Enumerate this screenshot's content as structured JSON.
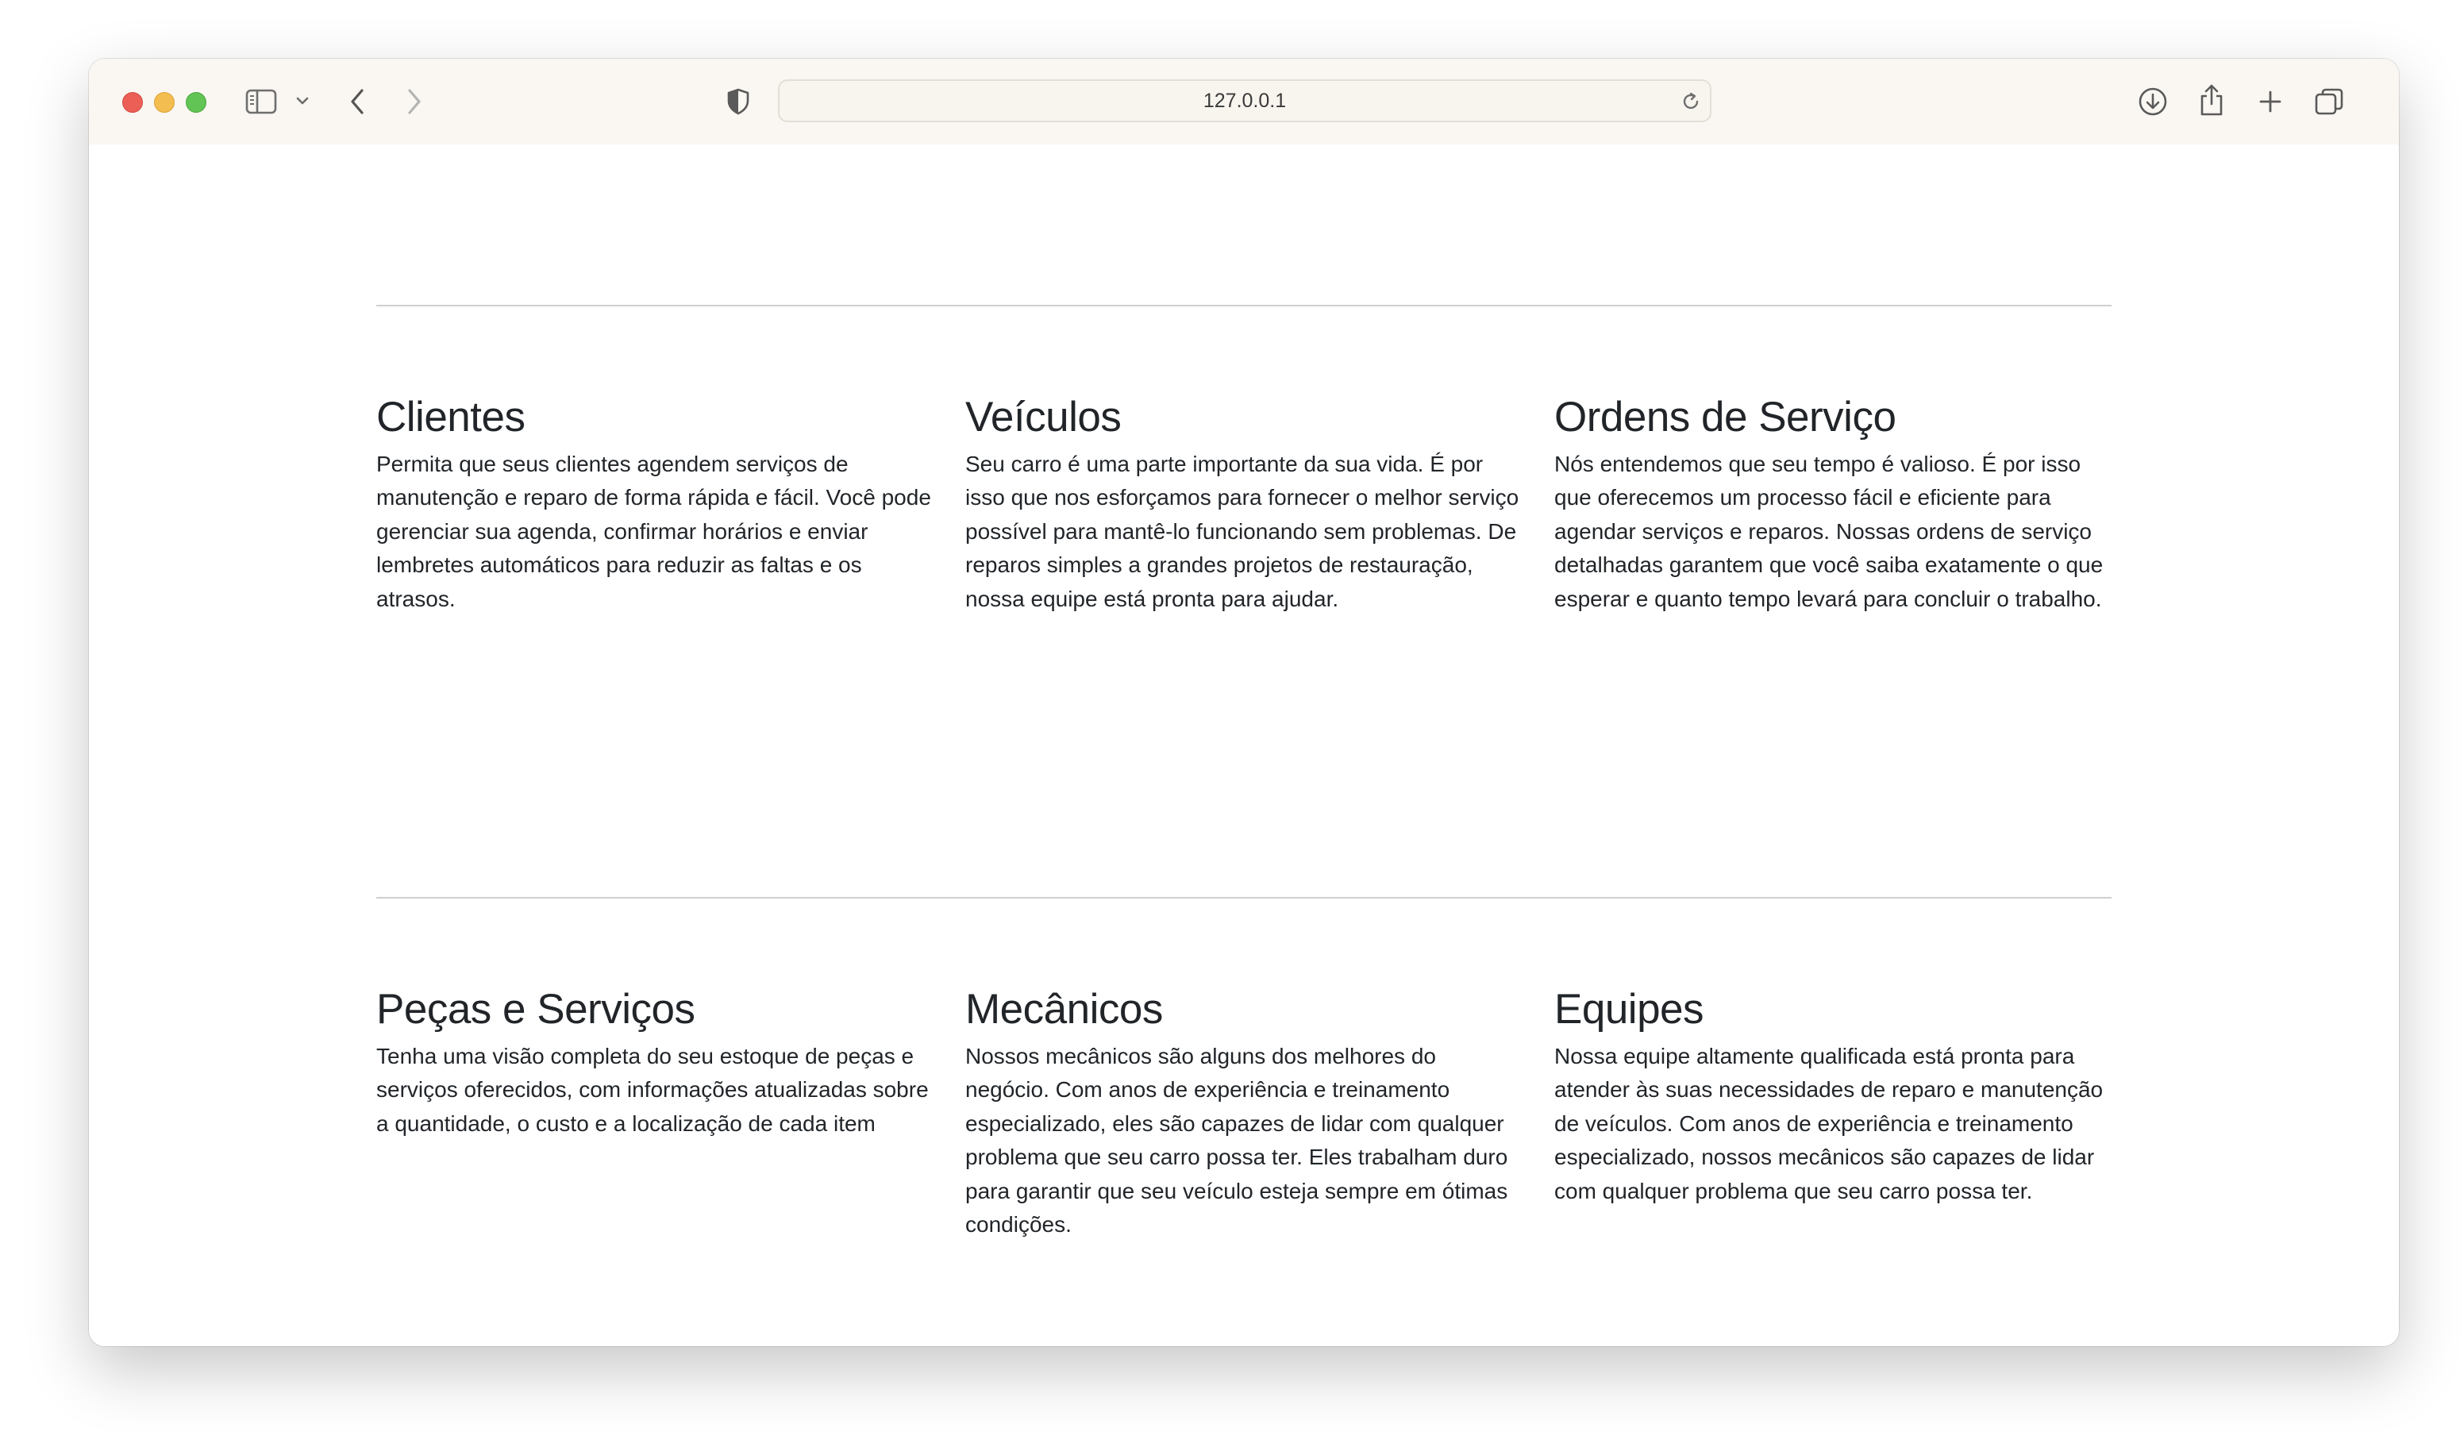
{
  "browser": {
    "url": "127.0.0.1"
  },
  "rows": [
    {
      "features": [
        {
          "title": "Clientes",
          "text": "Permita que seus clientes agendem serviços de manutenção e reparo de forma rápida e fácil. Você pode gerenciar sua agenda, confirmar horários e enviar lembretes automáticos para reduzir as faltas e os atrasos."
        },
        {
          "title": "Veículos",
          "text": "Seu carro é uma parte importante da sua vida. É por isso que nos esforçamos para fornecer o melhor serviço possível para mantê-lo funcionando sem problemas. De reparos simples a grandes projetos de restauração, nossa equipe está pronta para ajudar."
        },
        {
          "title": "Ordens de Serviço",
          "text": "Nós entendemos que seu tempo é valioso. É por isso que oferecemos um processo fácil e eficiente para agendar serviços e reparos. Nossas ordens de serviço detalhadas garantem que você saiba exatamente o que esperar e quanto tempo levará para concluir o trabalho."
        }
      ]
    },
    {
      "features": [
        {
          "title": "Peças e Serviços",
          "text": "Tenha uma visão completa do seu estoque de peças e serviços oferecidos, com informações atualizadas sobre a quantidade, o custo e a localização de cada item"
        },
        {
          "title": "Mecânicos",
          "text": "Nossos mecânicos são alguns dos melhores do negócio. Com anos de experiência e treinamento especializado, eles são capazes de lidar com qualquer problema que seu carro possa ter. Eles trabalham duro para garantir que seu veículo esteja sempre em ótimas condições."
        },
        {
          "title": "Equipes",
          "text": "Nossa equipe altamente qualificada está pronta para atender às suas necessidades de reparo e manutenção de veículos. Com anos de experiência e treinamento especializado, nossos mecânicos são capazes de lidar com qualquer problema que seu carro possa ter."
        }
      ]
    }
  ]
}
